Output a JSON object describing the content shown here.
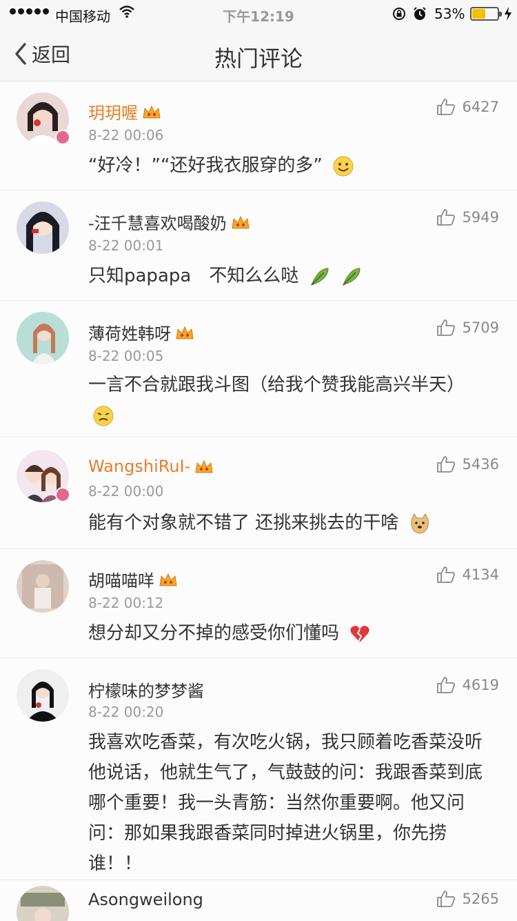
{
  "status_bar": {
    "carrier": "中国移动",
    "time": "下午12:19",
    "battery_percent": "53%",
    "battery_level": 0.53,
    "icons": [
      "signal-dots-icon",
      "wifi-icon",
      "rotation-lock-icon",
      "alarm-icon",
      "battery-icon",
      "charging-icon"
    ]
  },
  "nav": {
    "back_label": "返回",
    "title": "热门评论"
  },
  "comments": [
    {
      "user": "玥玥喔",
      "time": "8-22 00:06",
      "likes": "6427",
      "text": "“好冷！”“还好我衣服穿的多”",
      "emoji": "smile-emoji-icon"
    },
    {
      "user": "-汪千慧喜欢喝酸奶",
      "time": "8-22 00:01",
      "likes": "5949",
      "text": "只知papapa　不知么么哒",
      "emoji": "leaf-emoji-icon"
    },
    {
      "user": "薄荷姓韩呀",
      "time": "8-22 00:05",
      "likes": "5709",
      "text": "一言不合就跟我斗图（给我个赞我能高兴半天）",
      "emoji": "dizzy-emoji-icon"
    },
    {
      "user": "WangshiRuI-",
      "time": "8-22 00:00",
      "likes": "5436",
      "text": "能有个对象就不错了 还挑来挑去的干啥",
      "emoji": "doge-emoji-icon"
    },
    {
      "user": "胡喵喵咩",
      "time": "8-22 00:12",
      "likes": "4134",
      "text": "想分却又分不掉的感受你们懂吗",
      "emoji": "broken-heart-emoji-icon"
    },
    {
      "user": "柠檬味的梦梦酱",
      "time": "8-22 00:20",
      "likes": "4619",
      "text": "我喜欢吃香菜，有次吃火锅，我只顾着吃香菜没听他说话，他就生气了，气鼓鼓的问：我跟香菜到底哪个重要！我一头青筋：当然你重要啊。他又问问：那如果我跟香菜同时掉进火锅里，你先捞谁！！"
    },
    {
      "user": "Asongweilong",
      "likes": "5265"
    }
  ]
}
